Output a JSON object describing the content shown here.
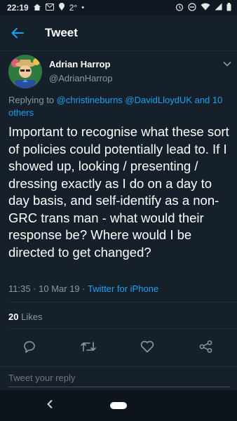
{
  "status_bar": {
    "time": "22:19",
    "temperature": "2°",
    "icons_left": [
      "home-icon",
      "gmail-icon",
      "location-icon",
      "dot-icon"
    ],
    "icons_right": [
      "alarm-icon",
      "dnd-icon",
      "wifi-icon",
      "signal-icon",
      "battery-icon"
    ]
  },
  "appbar": {
    "title": "Tweet"
  },
  "author": {
    "name": "Adrian Harrop",
    "handle": "@AdrianHarrop"
  },
  "replying": {
    "prefix": "Replying to",
    "mentions": "@christineburns @DavidLloydUK and 10 others"
  },
  "tweet": {
    "text": "Important to recognise what these sort of policies could potentially lead to. If I showed up, looking / presenting / dressing exactly as I do on a day to day basis, and self-identify as a non-GRC trans man - what would their response be? Where would I be directed to get changed?",
    "timestamp": "11:35 · 10 Mar 19 · ",
    "source": "Twitter for iPhone"
  },
  "stats": {
    "likes_count": "20",
    "likes_label": "Likes"
  },
  "actions": [
    "reply-icon",
    "retweet-icon",
    "like-icon",
    "share-icon"
  ],
  "reply_box": {
    "placeholder": "Tweet your reply"
  },
  "colors": {
    "background": "#15202b",
    "accent": "#1da1f2",
    "muted": "#8899a6",
    "divider": "#22303c"
  }
}
